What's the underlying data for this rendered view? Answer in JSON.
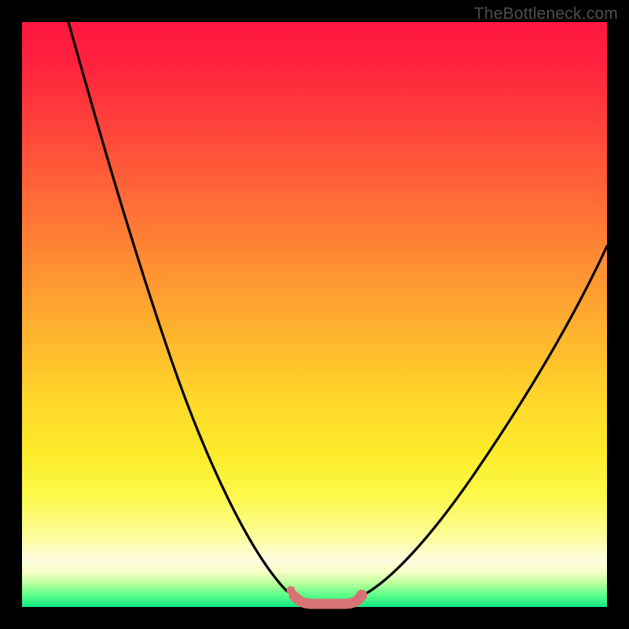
{
  "branding": {
    "watermark": "TheBottleneck.com"
  },
  "chart_data": {
    "type": "line",
    "title": "",
    "xlabel": "",
    "ylabel": "",
    "xlim": [
      0,
      100
    ],
    "ylim": [
      0,
      100
    ],
    "grid": false,
    "background_gradient": {
      "top_color": "#ff173f",
      "bottom_color": "#12e884",
      "description": "vertical red→orange→yellow→green gradient"
    },
    "series": [
      {
        "name": "left-branch",
        "stroke": "#000000",
        "x": [
          8,
          12,
          16,
          20,
          24,
          28,
          32,
          36,
          40,
          44,
          46.5
        ],
        "y": [
          100,
          89,
          78,
          67,
          56,
          46,
          36,
          26,
          16,
          7,
          2
        ]
      },
      {
        "name": "right-branch",
        "stroke": "#000000",
        "x": [
          58,
          62,
          66,
          70,
          74,
          78,
          82,
          86,
          90,
          94,
          98,
          100
        ],
        "y": [
          2,
          5,
          9,
          14,
          19,
          25,
          31,
          37,
          44,
          51,
          58,
          62
        ]
      },
      {
        "name": "valley-highlight",
        "stroke": "#d97373",
        "x": [
          46.5,
          48,
          50,
          52,
          54,
          56,
          58
        ],
        "y": [
          2,
          0.8,
          0.5,
          0.5,
          0.5,
          0.8,
          2
        ]
      }
    ],
    "markers": [
      {
        "name": "valley-left-dot",
        "x": 46.0,
        "y": 2.8,
        "r": 0.7,
        "fill": "#d97373"
      },
      {
        "name": "valley-right-dot",
        "x": 58.0,
        "y": 2.0,
        "r": 0.9,
        "fill": "#d97373"
      }
    ],
    "annotations": []
  }
}
